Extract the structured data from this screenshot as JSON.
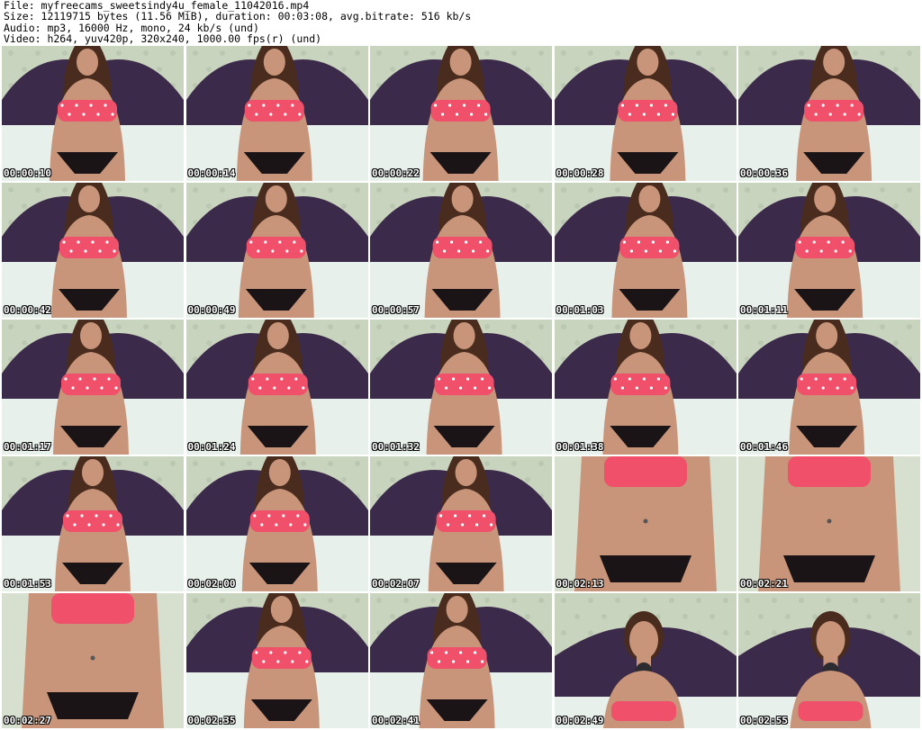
{
  "header": {
    "lines": [
      "File: myfreecams_sweetsindy4u_female_11042016.mp4",
      "Size: 12119715 bytes (11.56 MiB), duration: 00:03:08, avg.bitrate: 516 kb/s",
      "Audio: mp3, 16000 Hz, mono, 24 kb/s (und)",
      "Video: h264, yuv420p, 320x240, 1000.00 fps(r) (und)"
    ]
  },
  "frames": [
    {
      "timestamp": "00:00:10",
      "view": "wide"
    },
    {
      "timestamp": "00:00:14",
      "view": "wide"
    },
    {
      "timestamp": "00:00:22",
      "view": "wide"
    },
    {
      "timestamp": "00:00:28",
      "view": "wide"
    },
    {
      "timestamp": "00:00:36",
      "view": "wide"
    },
    {
      "timestamp": "00:00:42",
      "view": "wide"
    },
    {
      "timestamp": "00:00:49",
      "view": "wide"
    },
    {
      "timestamp": "00:00:57",
      "view": "wide"
    },
    {
      "timestamp": "00:01:03",
      "view": "wide"
    },
    {
      "timestamp": "00:01:11",
      "view": "wide"
    },
    {
      "timestamp": "00:01:17",
      "view": "wide"
    },
    {
      "timestamp": "00:01:24",
      "view": "wide"
    },
    {
      "timestamp": "00:01:32",
      "view": "wide"
    },
    {
      "timestamp": "00:01:38",
      "view": "wide"
    },
    {
      "timestamp": "00:01:46",
      "view": "wide"
    },
    {
      "timestamp": "00:01:53",
      "view": "wide"
    },
    {
      "timestamp": "00:02:00",
      "view": "wide"
    },
    {
      "timestamp": "00:02:07",
      "view": "wide"
    },
    {
      "timestamp": "00:02:13",
      "view": "close"
    },
    {
      "timestamp": "00:02:21",
      "view": "close"
    },
    {
      "timestamp": "00:02:27",
      "view": "close"
    },
    {
      "timestamp": "00:02:35",
      "view": "wide"
    },
    {
      "timestamp": "00:02:41",
      "view": "wide"
    },
    {
      "timestamp": "00:02:49",
      "view": "face"
    },
    {
      "timestamp": "00:02:55",
      "view": "face"
    }
  ],
  "colors": {
    "wall": "#c9d4bf",
    "headboard": "#3b2a4a",
    "bedsheet": "#e8f0ec",
    "skin": "#c9957a",
    "top": "#f0506a",
    "hair": "#4a2c1e",
    "briefs": "#1a1416"
  }
}
